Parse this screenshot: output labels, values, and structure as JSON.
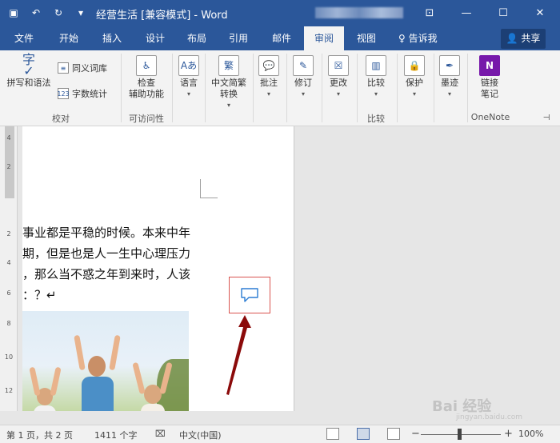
{
  "titlebar": {
    "doc_name": "经营生活 [兼容模式]  -  Word",
    "icons": [
      "save-icon",
      "undo-icon",
      "redo-icon",
      "customize-qat-icon"
    ]
  },
  "window_controls": {
    "ribbon_display": "⊡",
    "minimize": "—",
    "maximize": "☐",
    "close": "✕"
  },
  "tabs": [
    "文件",
    "开始",
    "插入",
    "设计",
    "布局",
    "引用",
    "邮件",
    "审阅",
    "视图"
  ],
  "active_tab": "审阅",
  "tell_me": "告诉我",
  "share_label": "共享",
  "ribbon": {
    "spelling": "拼写和语法",
    "thesaurus": "同义词库",
    "word_count": "字数统计",
    "proofing_group": "校对",
    "accessibility_l1": "检查",
    "accessibility_l2": "辅助功能",
    "accessibility_group": "可访问性",
    "language": "语言",
    "chinese_l1": "中文简繁",
    "chinese_l2": "转换",
    "comments": "批注",
    "tracking": "修订",
    "changes": "更改",
    "compare": "比较",
    "compare_group": "比较",
    "protect": "保护",
    "ink": "墨迹",
    "onenote_l1": "链接",
    "onenote_l2": "笔记",
    "onenote_group": "OneNote"
  },
  "ruler_ticks": [
    "4",
    "2",
    "2",
    "4",
    "6",
    "8",
    "10",
    "12"
  ],
  "document": {
    "lines": [
      "事业都是平稳的时候。本来中年",
      "期，但是也是人一生中心理压力",
      "，那么当不惑之年到来时，人该",
      "：？↵"
    ]
  },
  "status": {
    "page": "第 1 页，共 2 页",
    "words": "1411 个字",
    "language": "中文(中国)",
    "zoom": "100%"
  },
  "watermark": {
    "brand": "Bai 经验",
    "url": "jingyan.baidu.com"
  }
}
